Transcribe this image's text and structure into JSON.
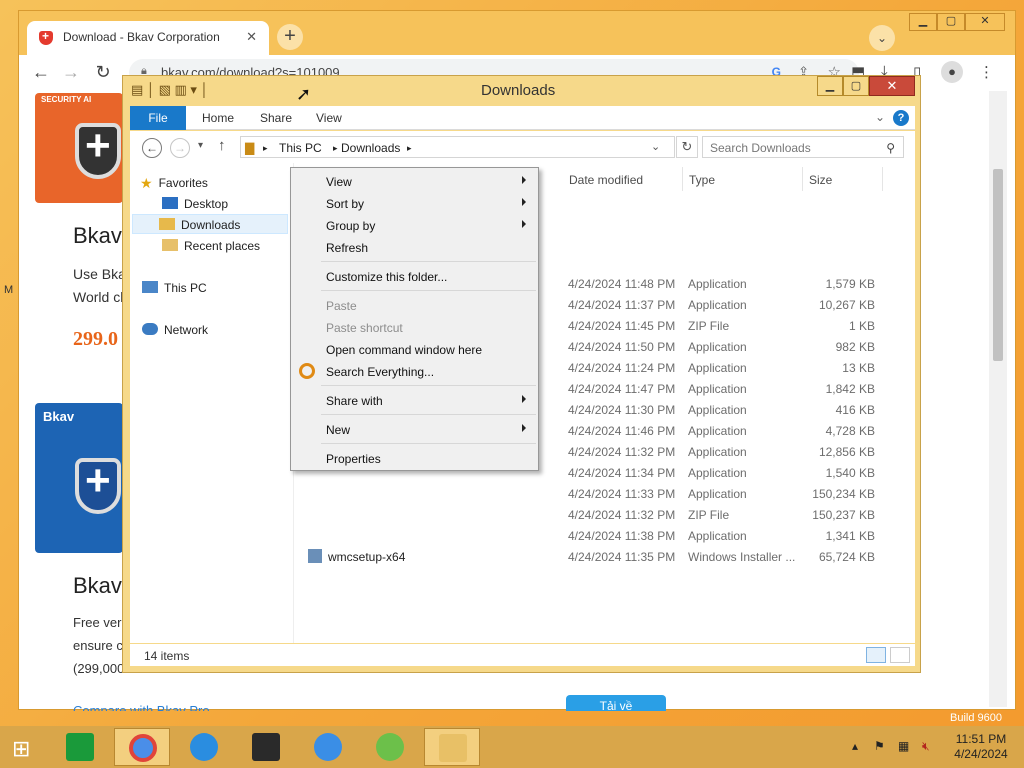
{
  "browser": {
    "tab_title": "Download - Bkav Corporation",
    "tab_close": "✕",
    "new_tab": "+",
    "url": "bkav.com/download?s=101009",
    "window_controls": [
      "▁",
      "▢",
      "✕"
    ]
  },
  "page": {
    "heading_1": "Bkav",
    "text_1a": "Use Bkav",
    "text_1b": "World cl",
    "price_1": "299.0",
    "box_1_label": "SECURITY AI",
    "heading_2": "Bkav",
    "box_2_label": "Bkav",
    "text_2a": "Free ver",
    "text_2b": "ensure c",
    "text_2c": "(299,000",
    "compare_link": "Compare with Bkav Pro",
    "download_button": "Tải về",
    "edge_text_left": "M",
    "edge_text_build": "Build 9600"
  },
  "explorer": {
    "title": "Downloads",
    "ribbon_tabs": [
      "File",
      "Home",
      "Share",
      "View"
    ],
    "breadcrumb": [
      "This PC",
      "Downloads"
    ],
    "search_placeholder": "Search Downloads",
    "nav": {
      "favorites": "Favorites",
      "desktop": "Desktop",
      "downloads": "Downloads",
      "recent": "Recent places",
      "this_pc": "This PC",
      "network": "Network"
    },
    "columns": [
      "Date modified",
      "Type",
      "Size"
    ],
    "rows": [
      {
        "name": "",
        "date": "4/24/2024 11:48 PM",
        "type": "Application",
        "size": "1,579 KB"
      },
      {
        "name": "",
        "date": "4/24/2024 11:37 PM",
        "type": "Application",
        "size": "10,267 KB"
      },
      {
        "name": "",
        "date": "4/24/2024 11:45 PM",
        "type": "ZIP File",
        "size": "1 KB"
      },
      {
        "name": "",
        "date": "4/24/2024 11:50 PM",
        "type": "Application",
        "size": "982 KB"
      },
      {
        "name": "",
        "date": "4/24/2024 11:24 PM",
        "type": "Application",
        "size": "13 KB"
      },
      {
        "name": "",
        "date": "4/24/2024 11:47 PM",
        "type": "Application",
        "size": "1,842 KB"
      },
      {
        "name": "",
        "date": "4/24/2024 11:30 PM",
        "type": "Application",
        "size": "416 KB"
      },
      {
        "name": "",
        "date": "4/24/2024 11:46 PM",
        "type": "Application",
        "size": "4,728 KB"
      },
      {
        "name": "",
        "date": "4/24/2024 11:32 PM",
        "type": "Application",
        "size": "12,856 KB"
      },
      {
        "name": "",
        "date": "4/24/2024 11:34 PM",
        "type": "Application",
        "size": "1,540 KB"
      },
      {
        "name": "",
        "date": "4/24/2024 11:33 PM",
        "type": "Application",
        "size": "150,234 KB"
      },
      {
        "name": "",
        "date": "4/24/2024 11:32 PM",
        "type": "ZIP File",
        "size": "150,237 KB"
      },
      {
        "name": "",
        "date": "4/24/2024 11:38 PM",
        "type": "Application",
        "size": "1,341 KB"
      },
      {
        "name": "wmcsetup-x64",
        "date": "4/24/2024 11:35 PM",
        "type": "Windows Installer ...",
        "size": "65,724 KB"
      }
    ],
    "status": "14 items"
  },
  "context_menu": {
    "items": [
      {
        "label": "View",
        "submenu": true,
        "disabled": false
      },
      {
        "label": "Sort by",
        "submenu": true,
        "disabled": false
      },
      {
        "label": "Group by",
        "submenu": true,
        "disabled": false
      },
      {
        "label": "Refresh",
        "submenu": false,
        "disabled": false
      },
      {
        "label": "Customize this folder...",
        "submenu": false,
        "disabled": false
      },
      {
        "label": "Paste",
        "submenu": false,
        "disabled": true
      },
      {
        "label": "Paste shortcut",
        "submenu": false,
        "disabled": true
      },
      {
        "label": "Open command window here",
        "submenu": false,
        "disabled": false
      },
      {
        "label": "Search Everything...",
        "submenu": false,
        "disabled": false
      },
      {
        "label": "Share with",
        "submenu": true,
        "disabled": false
      },
      {
        "label": "New",
        "submenu": true,
        "disabled": false
      },
      {
        "label": "Properties",
        "submenu": false,
        "disabled": false
      }
    ]
  },
  "taskbar": {
    "time": "11:51 PM",
    "date": "4/24/2024"
  },
  "colors": {
    "accent": "#1979ca",
    "taskbar": "#d9a64a",
    "price": "#e8651a"
  }
}
